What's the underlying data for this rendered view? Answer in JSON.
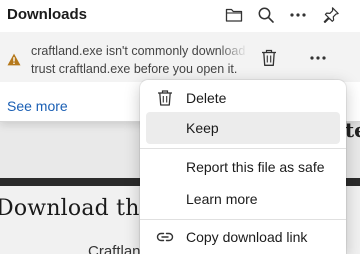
{
  "panel": {
    "title": "Downloads",
    "warning": {
      "line1": "craftland.exe isn't commonly download",
      "line2": "trust craftland.exe before you open it."
    },
    "see_more": "See more"
  },
  "background": {
    "heading_partial": "iste",
    "heading": "Download the Craf",
    "subtext": "Craftlan"
  },
  "menu": {
    "delete": "Delete",
    "keep": "Keep",
    "report": "Report this file as safe",
    "learn_more": "Learn more",
    "copy_link": "Copy download link"
  },
  "colors": {
    "link": "#1a5fb4",
    "warning_icon": "#b5781b",
    "menu_hover": "#ececec"
  },
  "icons": {
    "folder": "folder-icon",
    "search": "search-icon",
    "more": "more-icon",
    "pin": "pin-icon",
    "warning": "warning-icon",
    "trash": "trash-icon",
    "link": "link-icon"
  }
}
